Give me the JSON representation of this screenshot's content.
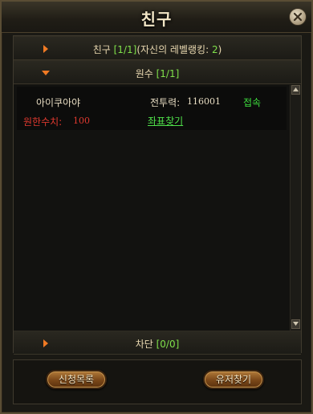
{
  "window": {
    "title": "친구"
  },
  "sections": {
    "friends": {
      "label": "친구",
      "count": "[1/1]",
      "note": "(자신의 레벨랭킹:",
      "rank": "2",
      "close_paren": ")"
    },
    "enemies": {
      "label": "원수",
      "count": "[1/1]"
    },
    "blocked": {
      "label": "차단",
      "count": "[0/0]"
    }
  },
  "enemy_list": [
    {
      "name": "아이쿠아야",
      "power_label": "전투력:",
      "power_value": "116001",
      "status": "접속",
      "grudge_label": "원한수치:",
      "grudge_value": "100",
      "coord_link": "좌표찾기"
    }
  ],
  "footer": {
    "request_list_label": "신청목록",
    "find_user_label": "유저찾기"
  },
  "colors": {
    "online": "#3ee03e",
    "grudge": "#e0392f",
    "count": "#7fe04a",
    "button": "#7a4718"
  },
  "icons": {
    "close": "close-icon",
    "expand": "chevron-right-icon",
    "collapse": "chevron-down-icon"
  }
}
